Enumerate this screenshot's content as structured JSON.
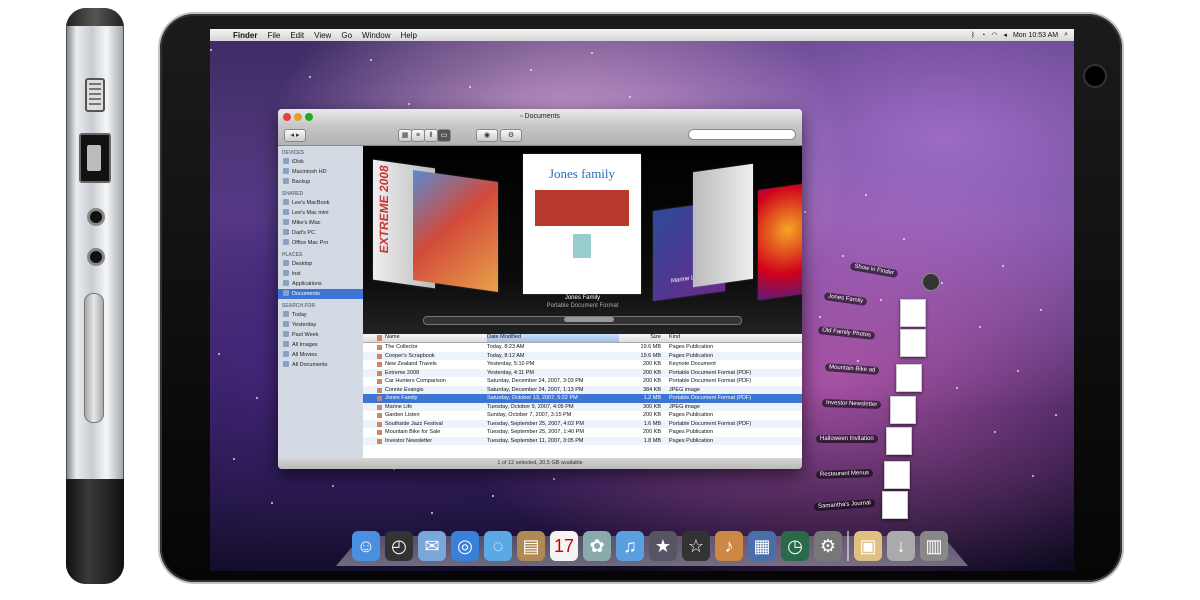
{
  "menubar": {
    "apple": "",
    "items": [
      "Finder",
      "File",
      "Edit",
      "View",
      "Go",
      "Window",
      "Help"
    ],
    "clock": "Mon 10:53 AM"
  },
  "finder": {
    "title": "Documents",
    "search_placeholder": "",
    "sidebar": {
      "sections": [
        {
          "header": "DEVICES",
          "items": [
            "iDisk",
            "Macintosh HD",
            "Backup"
          ]
        },
        {
          "header": "SHARED",
          "items": [
            "Lee's MacBook",
            "Lee's Mac mini",
            "Mike's iMac",
            "Dad's PC",
            "Office Mac Pro"
          ]
        },
        {
          "header": "PLACES",
          "items": [
            "Desktop",
            "lnst",
            "Applications",
            "Documents"
          ]
        },
        {
          "header": "SEARCH FOR",
          "items": [
            "Today",
            "Yesterday",
            "Past Week",
            "All Images",
            "All Movies",
            "All Documents"
          ]
        }
      ],
      "selected": "Documents"
    },
    "coverflow": {
      "caption_title": "Jones Family",
      "caption_sub": "Portable Document Format",
      "items": [
        "EXTREME 2008",
        "Jones family",
        "Marine Life"
      ]
    },
    "columns": [
      "Name",
      "Date Modified",
      "Size",
      "Kind"
    ],
    "rows": [
      {
        "name": "The Collector",
        "date": "Today, 8:23 AM",
        "size": "19.6 MB",
        "kind": "Pages Publication"
      },
      {
        "name": "Cooper's Scrapbook",
        "date": "Today, 8:12 AM",
        "size": "19.6 MB",
        "kind": "Pages Publication"
      },
      {
        "name": "New Zealand Travels",
        "date": "Yesterday, 5:10 PM",
        "size": "200 KB",
        "kind": "Keynote Document"
      },
      {
        "name": "Extreme 2008",
        "date": "Yesterday, 4:11 PM",
        "size": "200 KB",
        "kind": "Portable Document Format (PDF)"
      },
      {
        "name": "Car Hunters Comparison",
        "date": "Saturday, December 24, 2007, 3:03 PM",
        "size": "200 KB",
        "kind": "Portable Document Format (PDF)"
      },
      {
        "name": "Connie Evangis",
        "date": "Saturday, December 24, 2007, 1:13 PM",
        "size": "384 KB",
        "kind": "JPEG image"
      },
      {
        "name": "Jones Family",
        "date": "Saturday, October 13, 2007, 5:22 PM",
        "size": "1.2 MB",
        "kind": "Portable Document Format (PDF)"
      },
      {
        "name": "Marine Life",
        "date": "Tuesday, October 9, 2007, 4:05 PM",
        "size": "300 KB",
        "kind": "JPEG image"
      },
      {
        "name": "Garden Listen",
        "date": "Sunday, October 7, 2007, 3:15 PM",
        "size": "200 KB",
        "kind": "Pages Publication"
      },
      {
        "name": "Southside Jazz Festival",
        "date": "Tuesday, September 25, 2007, 4:02 PM",
        "size": "1.6 MB",
        "kind": "Portable Document Format (PDF)"
      },
      {
        "name": "Mountain Bike for Sale",
        "date": "Tuesday, September 25, 2007, 1:40 PM",
        "size": "200 KB",
        "kind": "Pages Publication"
      },
      {
        "name": "Investor Newsletter",
        "date": "Tuesday, September 11, 2007, 3:05 PM",
        "size": "1.8 MB",
        "kind": "Pages Publication"
      }
    ],
    "selected_row": 6,
    "status": "1 of 12 selected, 20.5 GB available"
  },
  "stack": {
    "items": [
      "Show in Finder",
      "Jones Family",
      "Old Family Photos",
      "Mountain Bike ad",
      "Investor Newsletter",
      "Halloween Invitation",
      "Restaurant Menus",
      "Samantha's Journal"
    ]
  },
  "dock": {
    "icons": [
      "finder-icon",
      "dashboard-icon",
      "mail-icon",
      "safari-icon",
      "ichat-icon",
      "address-book-icon",
      "ical-icon",
      "iphoto-icon",
      "itunes-icon",
      "imovie-icon",
      "star-icon",
      "garageband-icon",
      "spaces-icon",
      "time-machine-icon",
      "system-preferences-icon",
      "documents-stack-icon",
      "downloads-stack-icon",
      "trash-icon"
    ]
  },
  "colors": {
    "selection": "#3e74d4",
    "bezel": "#0a0a0a"
  }
}
